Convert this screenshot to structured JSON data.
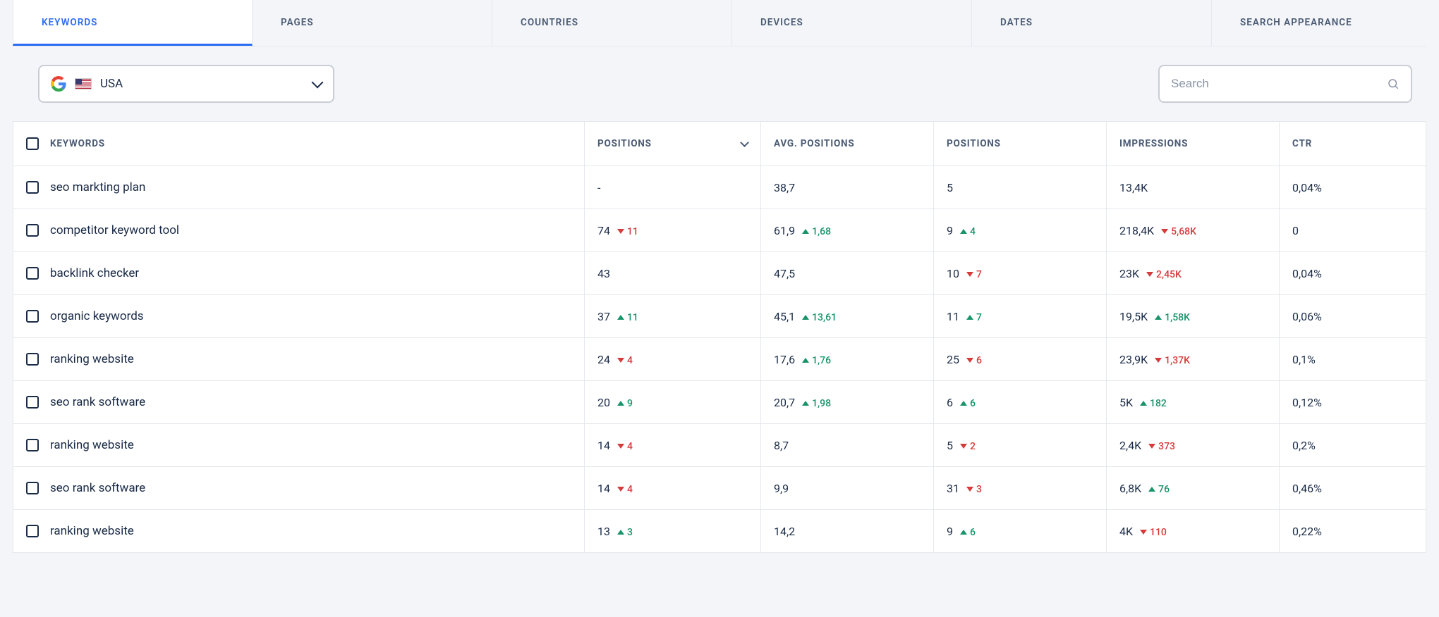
{
  "tabs": [
    "KEYWORDS",
    "PAGES",
    "COUNTRIES",
    "DEVICES",
    "DATES",
    "SEARCH APPEARANCE"
  ],
  "activeTab": 0,
  "country": {
    "label": "USA"
  },
  "search": {
    "placeholder": "Search"
  },
  "columns": [
    "KEYWORDS",
    "POSITIONS",
    "AVG. POSITIONS",
    "POSITIONS",
    "IMPRESSIONS",
    "CTR"
  ],
  "rows": [
    {
      "keyword": "seo markting plan",
      "pos": "-",
      "posD": null,
      "posDir": null,
      "avg": "38,7",
      "avgD": null,
      "avgDir": null,
      "pos2": "5",
      "pos2D": null,
      "pos2Dir": null,
      "imp": "13,4K",
      "impD": null,
      "impDir": null,
      "ctr": "0,04%"
    },
    {
      "keyword": "competitor keyword tool",
      "pos": "74",
      "posD": "11",
      "posDir": "down",
      "avg": "61,9",
      "avgD": "1,68",
      "avgDir": "up",
      "pos2": "9",
      "pos2D": "4",
      "pos2Dir": "up",
      "imp": "218,4K",
      "impD": "5,68K",
      "impDir": "down",
      "ctr": "0"
    },
    {
      "keyword": "backlink checker",
      "pos": "43",
      "posD": null,
      "posDir": null,
      "avg": "47,5",
      "avgD": null,
      "avgDir": null,
      "pos2": "10",
      "pos2D": "7",
      "pos2Dir": "down",
      "imp": "23K",
      "impD": "2,45K",
      "impDir": "down",
      "ctr": "0,04%"
    },
    {
      "keyword": "organic keywords",
      "pos": "37",
      "posD": "11",
      "posDir": "up",
      "avg": "45,1",
      "avgD": "13,61",
      "avgDir": "up",
      "pos2": "11",
      "pos2D": "7",
      "pos2Dir": "up",
      "imp": "19,5K",
      "impD": "1,58K",
      "impDir": "up",
      "ctr": "0,06%"
    },
    {
      "keyword": "ranking website",
      "pos": "24",
      "posD": "4",
      "posDir": "down",
      "avg": "17,6",
      "avgD": "1,76",
      "avgDir": "up",
      "pos2": "25",
      "pos2D": "6",
      "pos2Dir": "down",
      "imp": "23,9K",
      "impD": "1,37K",
      "impDir": "down",
      "ctr": "0,1%"
    },
    {
      "keyword": "seo rank software",
      "pos": "20",
      "posD": "9",
      "posDir": "up",
      "avg": "20,7",
      "avgD": "1,98",
      "avgDir": "up",
      "pos2": "6",
      "pos2D": "6",
      "pos2Dir": "up",
      "imp": "5K",
      "impD": "182",
      "impDir": "up",
      "ctr": "0,12%"
    },
    {
      "keyword": "ranking website",
      "pos": "14",
      "posD": "4",
      "posDir": "down",
      "avg": "8,7",
      "avgD": null,
      "avgDir": null,
      "pos2": "5",
      "pos2D": "2",
      "pos2Dir": "down",
      "imp": "2,4K",
      "impD": "373",
      "impDir": "down",
      "ctr": "0,2%"
    },
    {
      "keyword": "seo rank software",
      "pos": "14",
      "posD": "4",
      "posDir": "down",
      "avg": "9,9",
      "avgD": null,
      "avgDir": null,
      "pos2": "31",
      "pos2D": "3",
      "pos2Dir": "down",
      "imp": "6,8K",
      "impD": "76",
      "impDir": "up",
      "ctr": "0,46%"
    },
    {
      "keyword": "ranking website",
      "pos": "13",
      "posD": "3",
      "posDir": "up",
      "avg": "14,2",
      "avgD": null,
      "avgDir": null,
      "pos2": "9",
      "pos2D": "6",
      "pos2Dir": "up",
      "imp": "4K",
      "impD": "110",
      "impDir": "down",
      "ctr": "0,22%"
    }
  ]
}
